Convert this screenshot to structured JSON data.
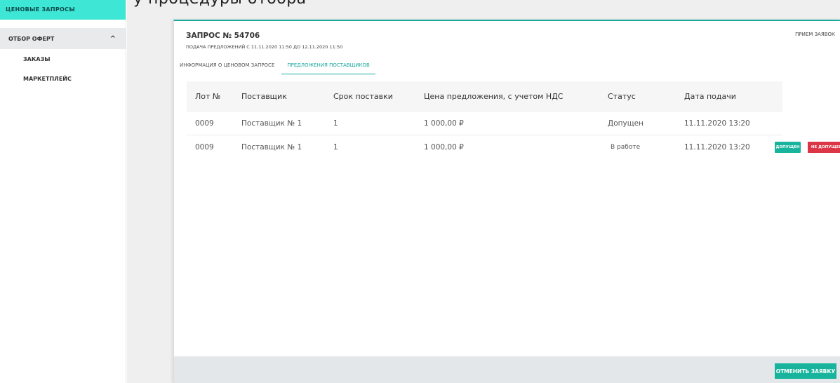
{
  "top_strip": "у процедуры отбора",
  "sidebar": {
    "active_item": "ЦЕНОВЫЕ ЗАПРОСЫ",
    "group_label": "ОТБОР ОФЕРТ",
    "group_icon": "chevron-up-icon",
    "sub_items": [
      {
        "label": "ЗАКАЗЫ"
      },
      {
        "label": "МАРКЕТПЛЕЙС"
      }
    ]
  },
  "header": {
    "title": "ЗАПРОС № 54706",
    "subtitle": "ПОДАЧА ПРЕДЛОЖЕНИЙ С 11.11.2020 11:50 ДО 12.11.2020 11:50",
    "reception": "ПРИЕМ ЗАЯВОК"
  },
  "tabs": [
    {
      "label": "ИНФОРМАЦИЯ О ЦЕНОВОМ ЗАПРОСЕ",
      "active": false
    },
    {
      "label": "ПРЕДЛОЖЕНИЯ ПОСТАВЩИКОВ",
      "active": true
    }
  ],
  "table": {
    "columns": [
      "Лот №",
      "Поставщик",
      "Срок поставки",
      "Цена предложения, с учетом НДС",
      "Статус",
      "Дата подачи"
    ],
    "rows": [
      {
        "lot": "0009",
        "supplier": "Поставщик № 1",
        "term": "1",
        "price": "1 000,00 ₽",
        "status": "Допущен",
        "date": "11.11.2020 13:20"
      },
      {
        "lot": "0009",
        "supplier": "Поставщик № 1",
        "term": "1",
        "price": "1 000,00 ₽",
        "status": "В работе",
        "date": "11.11.2020 13:20",
        "actions": {
          "approve": "ДОПУЩЕН",
          "reject": "НЕ ДОПУЩЕН"
        }
      }
    ]
  },
  "footer": {
    "cancel_label": "ОТМЕНИТЬ ЗАЯВКУ"
  },
  "colors": {
    "accent": "#1ba99c",
    "sidebar_active_bg": "#3ee6d6",
    "approve_btn": "#17b39c",
    "reject_btn": "#dc3545"
  }
}
